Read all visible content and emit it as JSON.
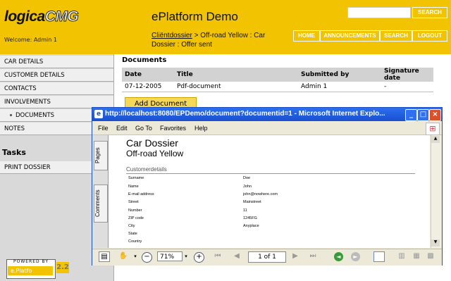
{
  "header": {
    "logo_main": "logica",
    "logo_accent": "CMG",
    "welcome": "Welcome: Admin 1",
    "app_title": "ePlatform Demo",
    "breadcrumb_link": "Cliëntdossier",
    "breadcrumb_rest": " > Off-road Yellow : Car Dossier : Offer sent",
    "search_button": "SEARCH",
    "nav": {
      "home": "HOME",
      "announcements": "ANNOUNCEMENTS",
      "search": "SEARCH",
      "logout": "LOGOUT"
    },
    "brand_color": "#f2c300"
  },
  "sidebar": {
    "items": [
      {
        "label": "CAR DETAILS"
      },
      {
        "label": "CUSTOMER DETAILS"
      },
      {
        "label": "CONTACTS"
      },
      {
        "label": "INVOLVEMENTS"
      },
      {
        "label": "DOCUMENTS"
      },
      {
        "label": "NOTES"
      }
    ],
    "tasks_title": "Tasks",
    "tasks": [
      {
        "label": "PRINT DOSSIER"
      }
    ],
    "powered_label": "POWERED BY",
    "powered_brand": "e.Platfo",
    "powered_version": "2.2"
  },
  "documents": {
    "heading": "Documents",
    "columns": [
      "Date",
      "Title",
      "Submitted by",
      "Signature date"
    ],
    "rows": [
      [
        "07-12-2005",
        "Pdf-document",
        "Admin 1",
        "-"
      ]
    ],
    "add_button": "Add Document"
  },
  "ie_window": {
    "title": "http://localhost:8080/EPDemo/document?documentid=1 - Microsoft Internet Explo...",
    "menu": [
      "File",
      "Edit",
      "Go To",
      "Favorites",
      "Help"
    ],
    "side_tabs": {
      "pages": "Pages",
      "comments": "Comments"
    },
    "pdf": {
      "title": "Car Dossier",
      "subtitle": "Off-road Yellow",
      "section": "Customerdetails",
      "fields": [
        {
          "label": "Surname",
          "value": "Doe"
        },
        {
          "label": "Name",
          "value": "John"
        },
        {
          "label": "E-mail address",
          "value": "john@nowhere.com"
        },
        {
          "label": "Street",
          "value": "Mainstreet"
        },
        {
          "label": "Number",
          "value": "11"
        },
        {
          "label": "ZIP code",
          "value": "1245FG"
        },
        {
          "label": "City",
          "value": "Anyplace"
        },
        {
          "label": "State",
          "value": ""
        },
        {
          "label": "Country",
          "value": ""
        }
      ]
    },
    "toolbar": {
      "zoom": "71%",
      "page": "1 of 1"
    }
  }
}
